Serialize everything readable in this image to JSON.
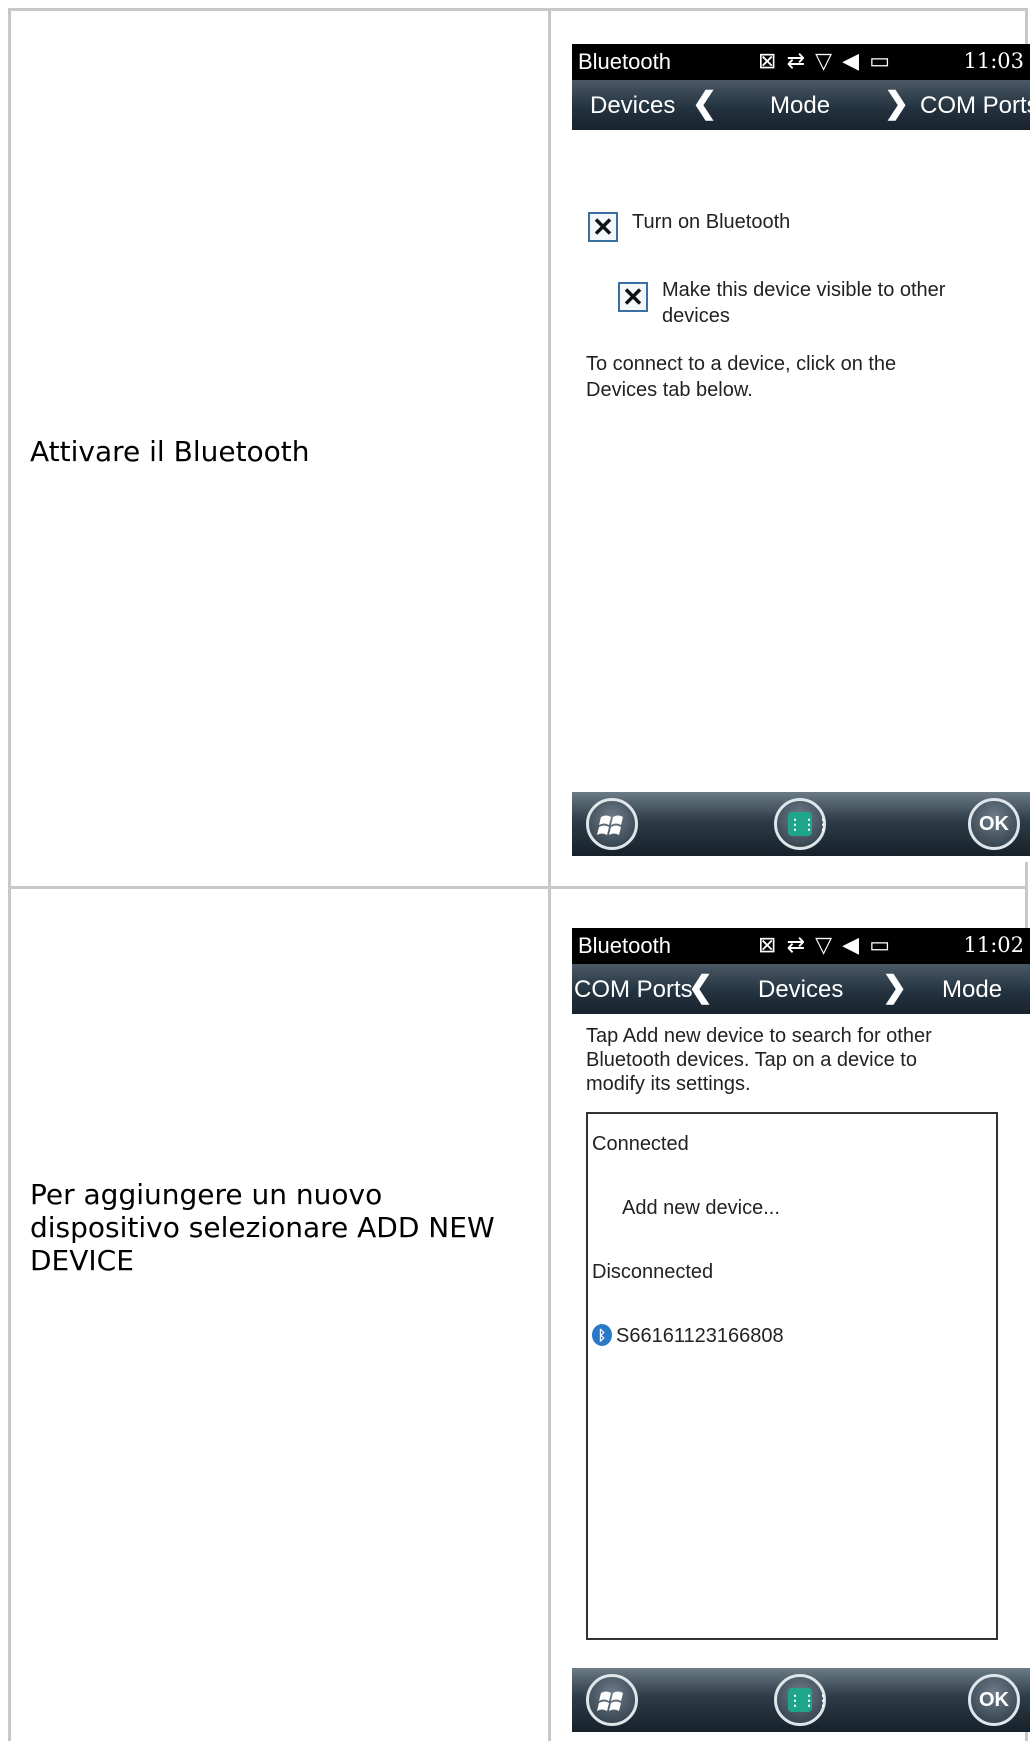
{
  "rows": [
    {
      "caption": "Attivare il Bluetooth",
      "screen": {
        "status": {
          "app": "Bluetooth",
          "time": "11:03"
        },
        "tabs": {
          "left": "Devices",
          "center": "Mode",
          "right": "COM Ports"
        },
        "checkboxes": [
          {
            "label": "Turn on Bluetooth",
            "checked": true
          },
          {
            "label_line1": "Make this device visible to other",
            "label_line2": "devices",
            "checked": true
          }
        ],
        "info_line1": "To connect to a device, click on the",
        "info_line2": "Devices tab below.",
        "ok_label": "OK"
      }
    },
    {
      "caption_line1": "Per aggiungere un nuovo",
      "caption_line2": "dispositivo selezionare ADD NEW",
      "caption_line3": "DEVICE",
      "screen": {
        "status": {
          "app": "Bluetooth",
          "time": "11:02"
        },
        "tabs": {
          "left": "COM Ports",
          "center": "Devices",
          "right": "Mode"
        },
        "intro_line1": "Tap Add new device to search for other",
        "intro_line2": "Bluetooth devices. Tap on a device to",
        "intro_line3": "modify its settings.",
        "list": {
          "connected_header": "Connected",
          "add_item": "Add new device...",
          "disconnected_header": "Disconnected",
          "device": "S66161123166808"
        },
        "ok_label": "OK"
      }
    }
  ]
}
